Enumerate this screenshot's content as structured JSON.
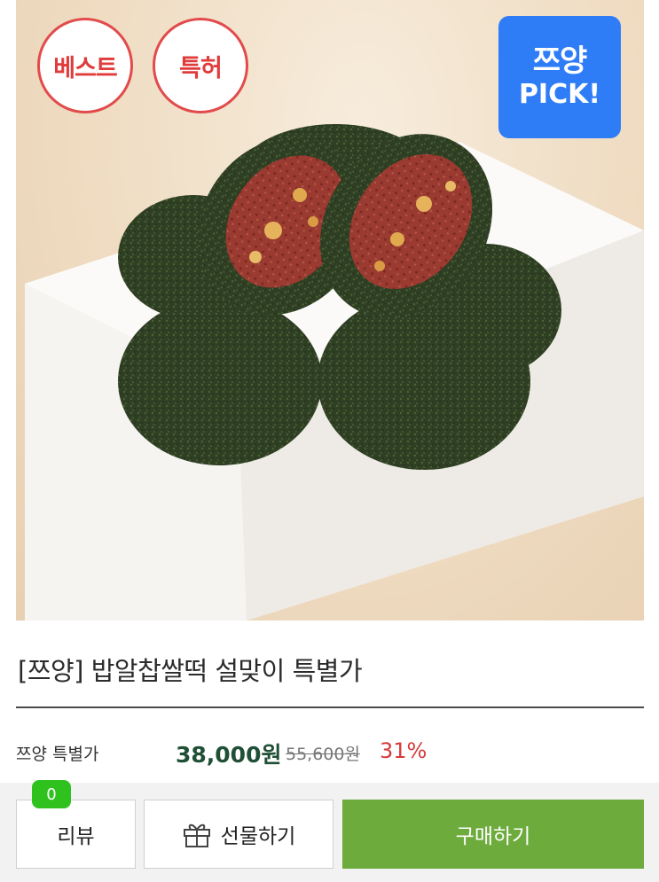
{
  "product": {
    "badges": {
      "best": "베스트",
      "patent": "특허"
    },
    "pick_badge": {
      "line1": "쯔양",
      "line2": "PICK!"
    },
    "title": "[쯔양] 밥알찹쌀떡 설맞이 특별가"
  },
  "price": {
    "label": "쯔양 특별가",
    "sale": "38,000원",
    "original": "55,600원",
    "discount": "31%"
  },
  "actions": {
    "review_label": "리뷰",
    "review_count": "0",
    "gift_label": "선물하기",
    "buy_label": "구매하기"
  },
  "colors": {
    "badge_red": "#e24b4b",
    "pick_blue": "#2f7df6",
    "sale_green": "#1f4f35",
    "discount_red": "#d63a3a",
    "buy_green": "#6cab3c",
    "count_green": "#2fc21f"
  },
  "icons": {
    "gift": "gift-icon"
  }
}
